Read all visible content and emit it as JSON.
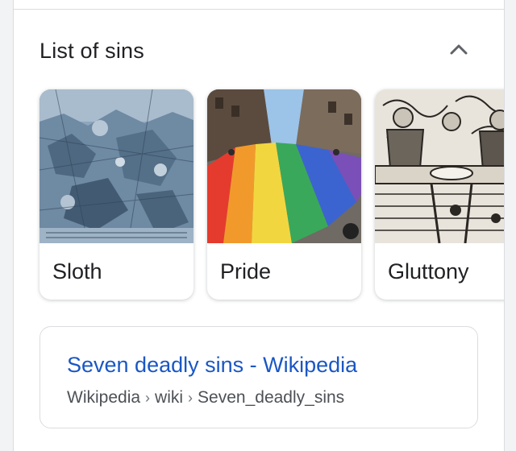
{
  "section": {
    "title": "List of sins",
    "collapse_icon": "chevron-up-icon"
  },
  "cards": [
    {
      "label": "Sloth",
      "image": "engraving-artwork-blue"
    },
    {
      "label": "Pride",
      "image": "rainbow-flag-parade-photo"
    },
    {
      "label": "Gluttony",
      "image": "woodcut-feast-scene"
    }
  ],
  "result": {
    "title": "Seven deadly sins - Wikipedia",
    "breadcrumb": [
      "Wikipedia",
      "wiki",
      "Seven_deadly_sins"
    ]
  },
  "colors": {
    "link": "#1a57c4",
    "text": "#202124",
    "muted": "#4d5156",
    "border": "#dadce0"
  }
}
